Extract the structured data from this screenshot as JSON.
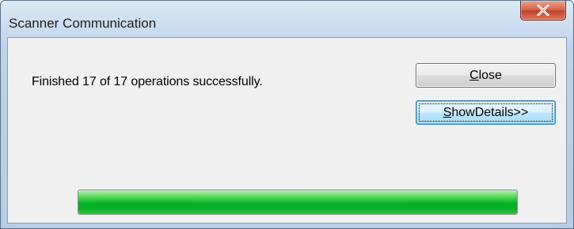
{
  "window": {
    "title": "Scanner Communication",
    "close_glyph": "X"
  },
  "dialog": {
    "message": "Finished 17 of 17 operations successfully.",
    "buttons": {
      "close": {
        "accel": "C",
        "rest": "lose"
      },
      "show_details": {
        "accel": "S",
        "rest": "howDetails>>"
      }
    },
    "progress": {
      "fraction": 1.0
    }
  },
  "colors": {
    "progress_green": "#06b025",
    "close_button_red": "#c2412a",
    "focused_button_border": "#3c7fb1"
  },
  "icons": {
    "window_close": "close-icon"
  }
}
